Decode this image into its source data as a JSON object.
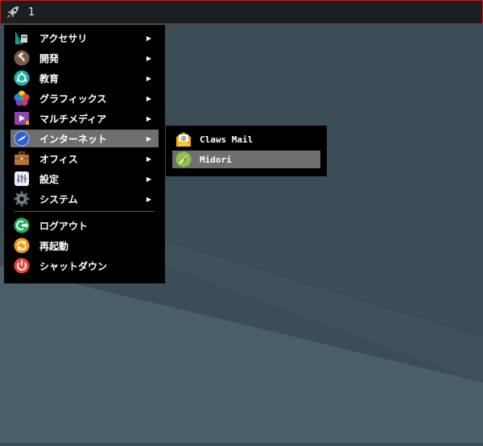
{
  "taskbar": {
    "workspace_number": "1",
    "launcher_icon": "rocket-icon"
  },
  "menu": {
    "items": [
      {
        "label": "アクセサリ",
        "icon": "accessories-icon",
        "has_submenu": true
      },
      {
        "label": "開発",
        "icon": "development-icon",
        "has_submenu": true
      },
      {
        "label": "教育",
        "icon": "education-icon",
        "has_submenu": true
      },
      {
        "label": "グラフィックス",
        "icon": "graphics-icon",
        "has_submenu": true
      },
      {
        "label": "マルチメディア",
        "icon": "multimedia-icon",
        "has_submenu": true
      },
      {
        "label": "インターネット",
        "icon": "internet-icon",
        "has_submenu": true,
        "selected": true
      },
      {
        "label": "オフィス",
        "icon": "office-icon",
        "has_submenu": true
      },
      {
        "label": "設定",
        "icon": "settings-icon",
        "has_submenu": true
      },
      {
        "label": "システム",
        "icon": "system-icon",
        "has_submenu": true
      }
    ],
    "actions": [
      {
        "label": "ログアウト",
        "icon": "logout-icon"
      },
      {
        "label": "再起動",
        "icon": "reboot-icon"
      },
      {
        "label": "シャットダウン",
        "icon": "shutdown-icon"
      }
    ]
  },
  "submenu": {
    "items": [
      {
        "label": "Claws Mail",
        "icon": "mail-icon"
      },
      {
        "label": "Midori",
        "icon": "browser-icon",
        "selected": true
      }
    ]
  },
  "colors": {
    "menu_bg": "#000000",
    "selection": "#6f6f6f",
    "taskbar_border": "#c01818"
  }
}
